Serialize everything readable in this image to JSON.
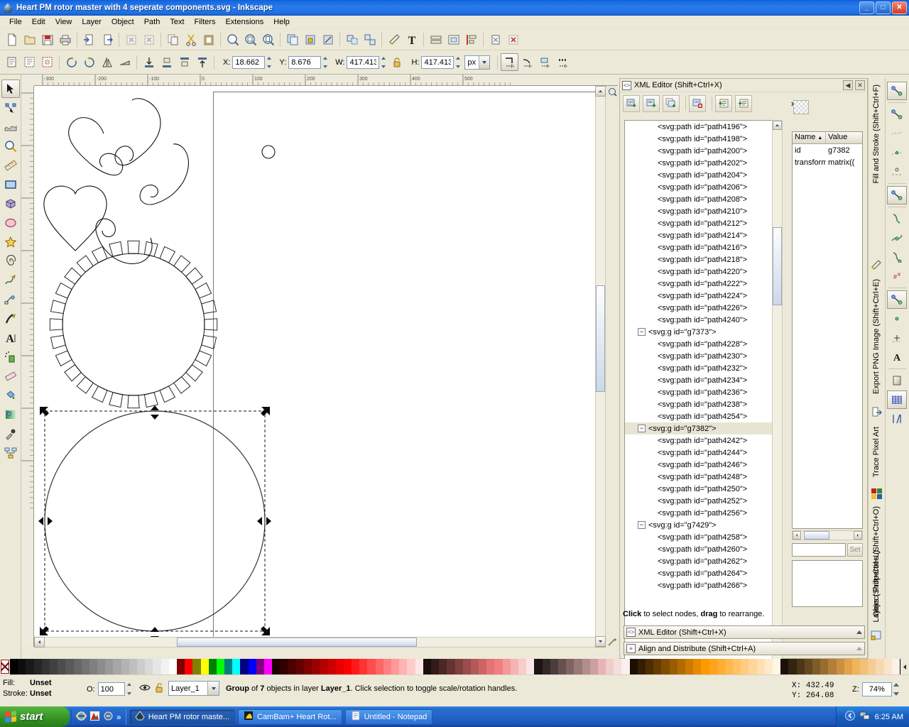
{
  "window": {
    "title": "Heart PM rotor master with 4 seperate components.svg - Inkscape",
    "app_icon": "inkscape-icon",
    "minimize": "_",
    "maximize": "□",
    "close": "✕"
  },
  "menu": {
    "items": [
      "File",
      "Edit",
      "View",
      "Layer",
      "Object",
      "Path",
      "Text",
      "Filters",
      "Extensions",
      "Help"
    ]
  },
  "commands_toolbar": {
    "buttons": [
      "new-document-icon",
      "open-document-icon",
      "save-document-icon",
      "print-document-icon",
      "import-icon",
      "export-icon",
      "undo-icon",
      "redo-icon",
      "copy-icon",
      "cut-icon",
      "paste-icon",
      "zoom-selection-icon",
      "zoom-drawing-icon",
      "zoom-page-icon",
      "duplicate-icon",
      "clone-icon",
      "unlink-clone-icon",
      "group-icon",
      "ungroup-icon",
      "fill-stroke-icon",
      "text-tool-icon",
      "xml-editor-icon",
      "align-distribute-icon",
      "preferences-icon",
      "document-properties-icon",
      "close-document-icon"
    ]
  },
  "tool_controls": {
    "x_label": "X:",
    "x_value": "18.662",
    "y_label": "Y:",
    "y_value": "8.676",
    "w_label": "W:",
    "w_value": "417.413",
    "h_label": "H:",
    "h_value": "417.413",
    "lock_icon": "unlocked-padlock-icon",
    "units": "px",
    "snap_buttons": [
      "affect-stroke-icon",
      "affect-corners-icon",
      "affect-gradients-icon",
      "affect-patterns-icon"
    ]
  },
  "toolbox": {
    "tools": [
      {
        "name": "selector-tool",
        "icon": "arrow-cursor-icon",
        "selected": true
      },
      {
        "name": "node-tool",
        "icon": "node-editor-icon",
        "selected": false
      },
      {
        "name": "tweak-tool",
        "icon": "tweak-wave-icon",
        "selected": false
      },
      {
        "name": "zoom-tool",
        "icon": "magnifier-icon",
        "selected": false
      },
      {
        "name": "measure-tool",
        "icon": "ruler-icon",
        "selected": false
      },
      {
        "name": "rectangle-tool",
        "icon": "rectangle-icon",
        "selected": false
      },
      {
        "name": "box3d-tool",
        "icon": "cube-icon",
        "selected": false
      },
      {
        "name": "ellipse-tool",
        "icon": "ellipse-icon",
        "selected": false
      },
      {
        "name": "star-tool",
        "icon": "star-icon",
        "selected": false
      },
      {
        "name": "spiral-tool",
        "icon": "spiral-icon",
        "selected": false
      },
      {
        "name": "pencil-tool",
        "icon": "pencil-freehand-icon",
        "selected": false
      },
      {
        "name": "bezier-tool",
        "icon": "bezier-pen-icon",
        "selected": false
      },
      {
        "name": "calligraphy-tool",
        "icon": "calligraphy-pen-icon",
        "selected": false
      },
      {
        "name": "text-tool",
        "icon": "letter-a-icon",
        "selected": false
      },
      {
        "name": "spray-tool",
        "icon": "spray-can-icon",
        "selected": false
      },
      {
        "name": "eraser-tool",
        "icon": "eraser-icon",
        "selected": false
      },
      {
        "name": "bucket-tool",
        "icon": "paint-bucket-icon",
        "selected": false
      },
      {
        "name": "gradient-tool",
        "icon": "gradient-icon",
        "selected": false
      },
      {
        "name": "dropper-tool",
        "icon": "eyedropper-icon",
        "selected": false
      },
      {
        "name": "connector-tool",
        "icon": "connector-icon",
        "selected": false
      }
    ]
  },
  "canvas": {
    "ruler_h_ticks": [
      "-300",
      "-200",
      "-100",
      "0",
      "100",
      "200",
      "300",
      "400",
      "500"
    ],
    "ruler_v_ticks": [
      "0",
      "100",
      "200",
      "300",
      "400",
      "500",
      "600",
      "700"
    ],
    "objects_description": "Five heart shapes arranged in a rotor pattern, one small circle, a slotted rotor ring, and one large selected circle",
    "selection": {
      "handles": "scale-arrows",
      "style": "dashed-bounding-box"
    }
  },
  "xml_editor": {
    "panel_title": "XML Editor (Shift+Ctrl+X)",
    "panel_icon": "xml-editor-icon",
    "collapse_icon": "◀",
    "close_icon": "✕",
    "toolbar_buttons": [
      "new-element-node-icon",
      "new-text-node-icon",
      "duplicate-node-icon",
      "delete-node-icon",
      "unindent-node-icon",
      "indent-node-icon"
    ],
    "overflow_icon": "»",
    "tree": [
      {
        "label": "<svg:path id=\"path4196\">",
        "depth": 2,
        "type": "path",
        "selected": false
      },
      {
        "label": "<svg:path id=\"path4198\">",
        "depth": 2,
        "type": "path",
        "selected": false
      },
      {
        "label": "<svg:path id=\"path4200\">",
        "depth": 2,
        "type": "path",
        "selected": false
      },
      {
        "label": "<svg:path id=\"path4202\">",
        "depth": 2,
        "type": "path",
        "selected": false
      },
      {
        "label": "<svg:path id=\"path4204\">",
        "depth": 2,
        "type": "path",
        "selected": false
      },
      {
        "label": "<svg:path id=\"path4206\">",
        "depth": 2,
        "type": "path",
        "selected": false
      },
      {
        "label": "<svg:path id=\"path4208\">",
        "depth": 2,
        "type": "path",
        "selected": false
      },
      {
        "label": "<svg:path id=\"path4210\">",
        "depth": 2,
        "type": "path",
        "selected": false
      },
      {
        "label": "<svg:path id=\"path4212\">",
        "depth": 2,
        "type": "path",
        "selected": false
      },
      {
        "label": "<svg:path id=\"path4214\">",
        "depth": 2,
        "type": "path",
        "selected": false
      },
      {
        "label": "<svg:path id=\"path4216\">",
        "depth": 2,
        "type": "path",
        "selected": false
      },
      {
        "label": "<svg:path id=\"path4218\">",
        "depth": 2,
        "type": "path",
        "selected": false
      },
      {
        "label": "<svg:path id=\"path4220\">",
        "depth": 2,
        "type": "path",
        "selected": false
      },
      {
        "label": "<svg:path id=\"path4222\">",
        "depth": 2,
        "type": "path",
        "selected": false
      },
      {
        "label": "<svg:path id=\"path4224\">",
        "depth": 2,
        "type": "path",
        "selected": false
      },
      {
        "label": "<svg:path id=\"path4226\">",
        "depth": 2,
        "type": "path",
        "selected": false
      },
      {
        "label": "<svg:path id=\"path4240\">",
        "depth": 2,
        "type": "path",
        "selected": false
      },
      {
        "label": "<svg:g id=\"g7373\">",
        "depth": 1,
        "type": "group",
        "selected": false,
        "expander": "−"
      },
      {
        "label": "<svg:path id=\"path4228\">",
        "depth": 2,
        "type": "path",
        "selected": false
      },
      {
        "label": "<svg:path id=\"path4230\">",
        "depth": 2,
        "type": "path",
        "selected": false
      },
      {
        "label": "<svg:path id=\"path4232\">",
        "depth": 2,
        "type": "path",
        "selected": false
      },
      {
        "label": "<svg:path id=\"path4234\">",
        "depth": 2,
        "type": "path",
        "selected": false
      },
      {
        "label": "<svg:path id=\"path4236\">",
        "depth": 2,
        "type": "path",
        "selected": false
      },
      {
        "label": "<svg:path id=\"path4238\">",
        "depth": 2,
        "type": "path",
        "selected": false
      },
      {
        "label": "<svg:path id=\"path4254\">",
        "depth": 2,
        "type": "path",
        "selected": false
      },
      {
        "label": "<svg:g id=\"g7382\">",
        "depth": 1,
        "type": "group",
        "selected": true,
        "expander": "−"
      },
      {
        "label": "<svg:path id=\"path4242\">",
        "depth": 2,
        "type": "path",
        "selected": false
      },
      {
        "label": "<svg:path id=\"path4244\">",
        "depth": 2,
        "type": "path",
        "selected": false
      },
      {
        "label": "<svg:path id=\"path4246\">",
        "depth": 2,
        "type": "path",
        "selected": false
      },
      {
        "label": "<svg:path id=\"path4248\">",
        "depth": 2,
        "type": "path",
        "selected": false
      },
      {
        "label": "<svg:path id=\"path4250\">",
        "depth": 2,
        "type": "path",
        "selected": false
      },
      {
        "label": "<svg:path id=\"path4252\">",
        "depth": 2,
        "type": "path",
        "selected": false
      },
      {
        "label": "<svg:path id=\"path4256\">",
        "depth": 2,
        "type": "path",
        "selected": false
      },
      {
        "label": "<svg:g id=\"g7429\">",
        "depth": 1,
        "type": "group",
        "selected": false,
        "expander": "−"
      },
      {
        "label": "<svg:path id=\"path4258\">",
        "depth": 2,
        "type": "path",
        "selected": false
      },
      {
        "label": "<svg:path id=\"path4260\">",
        "depth": 2,
        "type": "path",
        "selected": false
      },
      {
        "label": "<svg:path id=\"path4262\">",
        "depth": 2,
        "type": "path",
        "selected": false
      },
      {
        "label": "<svg:path id=\"path4264\">",
        "depth": 2,
        "type": "path",
        "selected": false
      },
      {
        "label": "<svg:path id=\"path4266\">",
        "depth": 2,
        "type": "path",
        "selected": false
      }
    ],
    "attributes": {
      "header_name": "Name",
      "header_value": "Value",
      "sort_arrow": "▲",
      "rows": [
        {
          "name": "id",
          "value": "g7382"
        },
        {
          "name": "transform",
          "value": "matrix(("
        }
      ]
    },
    "value_input": "",
    "set_button": "Set",
    "hint": "Click to select nodes, drag to rearrange.",
    "hint_bold_1": "Click",
    "hint_bold_2": "drag"
  },
  "docked_panels": [
    {
      "label": "XML Editor (Shift+Ctrl+X)",
      "icon": "xml-editor-icon",
      "expanded": true
    },
    {
      "label": "Align and Distribute (Shift+Ctrl+A)",
      "icon": "align-distribute-icon",
      "expanded": false
    }
  ],
  "vertical_tabs": [
    {
      "label": "Fill and Stroke (Shift+Ctrl+F)",
      "icon": "fill-stroke-icon"
    },
    {
      "label": "Export PNG Image (Shift+Ctrl+E)",
      "icon": "export-png-icon"
    },
    {
      "label": "Trace Pixel Art",
      "icon": "trace-pixel-art-icon"
    },
    {
      "label": "Object Properties (Shift+Ctrl+O)",
      "icon": "object-properties-icon"
    },
    {
      "label": "Layers (Shift+Ctrl+L)",
      "icon": "layers-icon"
    }
  ],
  "vertical_icons": [
    "node-edit-icon",
    "node-edit-icon",
    "path-dash-icon",
    "path-effect-icon",
    "path-marker-icon",
    "node-edit-icon",
    "curve-icon",
    "curve-node-icon",
    "curve-loop-icon",
    "text-effect-icon",
    "node-edit-icon",
    "dot-icon",
    "plus-node-icon",
    "letter-a-bold-icon",
    "gradient-square-icon",
    "grid-icon",
    "guides-icon"
  ],
  "status_bar": {
    "fill_label": "Fill:",
    "fill_value": "Unset",
    "stroke_label": "Stroke:",
    "stroke_value": "Unset",
    "opacity_label": "O:",
    "opacity_value": "100",
    "visibility_icon": "eye-open-icon",
    "lock_icon": "unlocked-padlock-icon",
    "layer_name": "Layer_1",
    "message_prefix": "Group",
    "message_mid": " of ",
    "message_count": "7",
    "message_suffix": " objects in layer ",
    "message_layer": "Layer_1",
    "message_tail": ". Click selection to toggle scale/rotation handles.",
    "coord_x_label": "X:",
    "coord_x": "432.49",
    "coord_y_label": "Y:",
    "coord_y": "264.08",
    "zoom_label": "Z:",
    "zoom_value": "74%"
  },
  "taskbar": {
    "start_label": "start",
    "quick_launch": [
      "internet-explorer-icon",
      "media-player-icon",
      "show-desktop-icon"
    ],
    "overflow": "»",
    "tasks": [
      {
        "label": "Heart PM rotor maste...",
        "icon": "inkscape-icon",
        "active": true
      },
      {
        "label": "CamBam+  Heart Rot...",
        "icon": "cambam-icon",
        "active": false
      },
      {
        "label": "Untitled - Notepad",
        "icon": "notepad-icon",
        "active": false
      }
    ],
    "tray_icons": [
      "show-hidden-icons-icon",
      "network-icon"
    ],
    "clock": "6:25 AM"
  },
  "palette": {
    "none_swatch": "none-swatch",
    "colors": [
      "#000000",
      "#0d0d0d",
      "#1a1a1a",
      "#262626",
      "#333333",
      "#404040",
      "#4d4d4d",
      "#595959",
      "#666666",
      "#737373",
      "#808080",
      "#8c8c8c",
      "#999999",
      "#a6a6a6",
      "#b3b3b3",
      "#bfbfbf",
      "#cccccc",
      "#d9d9d9",
      "#e6e6e6",
      "#f2f2f2",
      "#ffffff",
      "#800000",
      "#ff0000",
      "#808000",
      "#ffff00",
      "#008000",
      "#00ff00",
      "#008080",
      "#00ffff",
      "#000080",
      "#0000ff",
      "#800080",
      "#ff00ff",
      "#1a0000",
      "#330000",
      "#4d0000",
      "#660000",
      "#800000",
      "#990000",
      "#b30000",
      "#cc0000",
      "#e60000",
      "#ff0000",
      "#ff1a1a",
      "#ff3333",
      "#ff4d4d",
      "#ff6666",
      "#ff8080",
      "#ff9999",
      "#ffb3b3",
      "#ffcccc",
      "#ffe6e6",
      "#1a0d0d",
      "#331a1a",
      "#4d2626",
      "#663333",
      "#804040",
      "#994d4d",
      "#b35959",
      "#cc6666",
      "#e67373",
      "#f08080",
      "#f29999",
      "#f5b3b3",
      "#f7cccc",
      "#fae6e6",
      "#1a1414",
      "#332828",
      "#4d3c3c",
      "#665050",
      "#806464",
      "#997878",
      "#b38c8c",
      "#cca0a0",
      "#e6b4b4",
      "#f0cccc",
      "#f5dede",
      "#faeeee",
      "#1a0f00",
      "#331f00",
      "#4d2e00",
      "#663d00",
      "#804d00",
      "#995c00",
      "#b36b00",
      "#cc7a00",
      "#e68a00",
      "#ff9900",
      "#ffa31a",
      "#ffad33",
      "#ffb84d",
      "#ffc266",
      "#ffcc80",
      "#ffd699",
      "#ffe0b3",
      "#ffebcc",
      "#fff5e6",
      "#1a1208",
      "#332410",
      "#4d3618",
      "#664820",
      "#805a28",
      "#996c30",
      "#b37e38",
      "#cc9040",
      "#e6a248",
      "#f0b45c",
      "#f2c078",
      "#f5cc94",
      "#f7d8b0",
      "#fae4cc",
      "#fcf0e8"
    ]
  }
}
